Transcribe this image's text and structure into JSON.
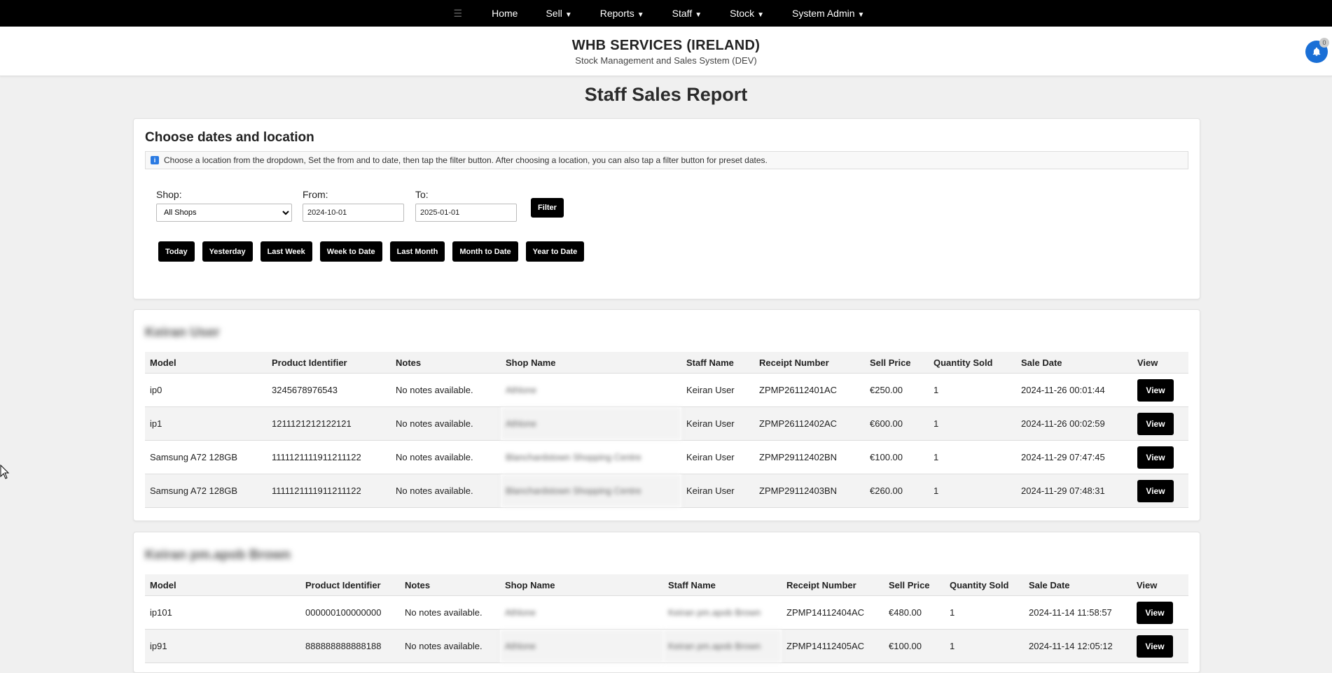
{
  "nav": {
    "menu_icon": "☰",
    "items": [
      {
        "label": "Home",
        "dropdown": false
      },
      {
        "label": "Sell",
        "dropdown": true
      },
      {
        "label": "Reports",
        "dropdown": true
      },
      {
        "label": "Staff",
        "dropdown": true
      },
      {
        "label": "Stock",
        "dropdown": true
      },
      {
        "label": "System Admin",
        "dropdown": true
      }
    ]
  },
  "header": {
    "company": "WHB SERVICES (IRELAND)",
    "subtitle": "Stock Management and Sales System (DEV)",
    "notification_count": "0"
  },
  "page_title": "Staff Sales Report",
  "filter_card": {
    "heading": "Choose dates and location",
    "info": "Choose a location from the dropdown, Set the from and to date, then tap the filter button. After choosing a location, you can also tap a filter button for preset dates.",
    "shop_label": "Shop:",
    "shop_value": "All Shops",
    "from_label": "From:",
    "from_value": "2024-10-01",
    "to_label": "To:",
    "to_value": "2025-01-01",
    "filter_button": "Filter",
    "presets": [
      "Today",
      "Yesterday",
      "Last Week",
      "Week to Date",
      "Last Month",
      "Month to Date",
      "Year to Date"
    ]
  },
  "staff_sections": [
    {
      "staff": "Keiran User",
      "columns": [
        "Model",
        "Product Identifier",
        "Notes",
        "Shop Name",
        "Staff Name",
        "Receipt Number",
        "Sell Price",
        "Quantity Sold",
        "Sale Date",
        "View"
      ],
      "rows": [
        {
          "model": "ip0",
          "identifier": "3245678976543",
          "notes": "No notes available.",
          "shop": "Athlone",
          "staff": "Keiran User",
          "receipt": "ZPMP26112401AC",
          "price": "€250.00",
          "qty": "1",
          "date": "2024-11-26 00:01:44",
          "view": "View"
        },
        {
          "model": "ip1",
          "identifier": "1211121212122121",
          "notes": "No notes available.",
          "shop": "Athlone",
          "staff": "Keiran User",
          "receipt": "ZPMP26112402AC",
          "price": "€600.00",
          "qty": "1",
          "date": "2024-11-26 00:02:59",
          "view": "View"
        },
        {
          "model": "Samsung A72 128GB",
          "identifier": "1111121111911211122",
          "notes": "No notes available.",
          "shop": "Blanchardstown Shopping Centre",
          "staff": "Keiran User",
          "receipt": "ZPMP29112402BN",
          "price": "€100.00",
          "qty": "1",
          "date": "2024-11-29 07:47:45",
          "view": "View"
        },
        {
          "model": "Samsung A72 128GB",
          "identifier": "1111121111911211122",
          "notes": "No notes available.",
          "shop": "Blanchardstown Shopping Centre",
          "staff": "Keiran User",
          "receipt": "ZPMP29112403BN",
          "price": "€260.00",
          "qty": "1",
          "date": "2024-11-29 07:48:31",
          "view": "View"
        }
      ]
    },
    {
      "staff": "Keiran pm.apob Brown",
      "columns": [
        "Model",
        "Product Identifier",
        "Notes",
        "Shop Name",
        "Staff Name",
        "Receipt Number",
        "Sell Price",
        "Quantity Sold",
        "Sale Date",
        "View"
      ],
      "rows": [
        {
          "model": "ip101",
          "identifier": "000000100000000",
          "notes": "No notes available.",
          "shop": "Athlone",
          "staff": "Keiran pm.apob Brown",
          "receipt": "ZPMP14112404AC",
          "price": "€480.00",
          "qty": "1",
          "date": "2024-11-14 11:58:57",
          "view": "View"
        },
        {
          "model": "ip91",
          "identifier": "888888888888188",
          "notes": "No notes available.",
          "shop": "Athlone",
          "staff": "Keiran pm.apob Brown",
          "receipt": "ZPMP14112405AC",
          "price": "€100.00",
          "qty": "1",
          "date": "2024-11-14 12:05:12",
          "view": "View"
        }
      ]
    }
  ],
  "icons": {
    "bell": "bell-icon",
    "info": "info-icon",
    "cursor": "mouse-pointer-icon"
  },
  "colors": {
    "nav_bg": "#000000",
    "bell_bg": "#1a6fd6",
    "button_bg": "#000000",
    "page_bg": "#f0f0f0"
  }
}
